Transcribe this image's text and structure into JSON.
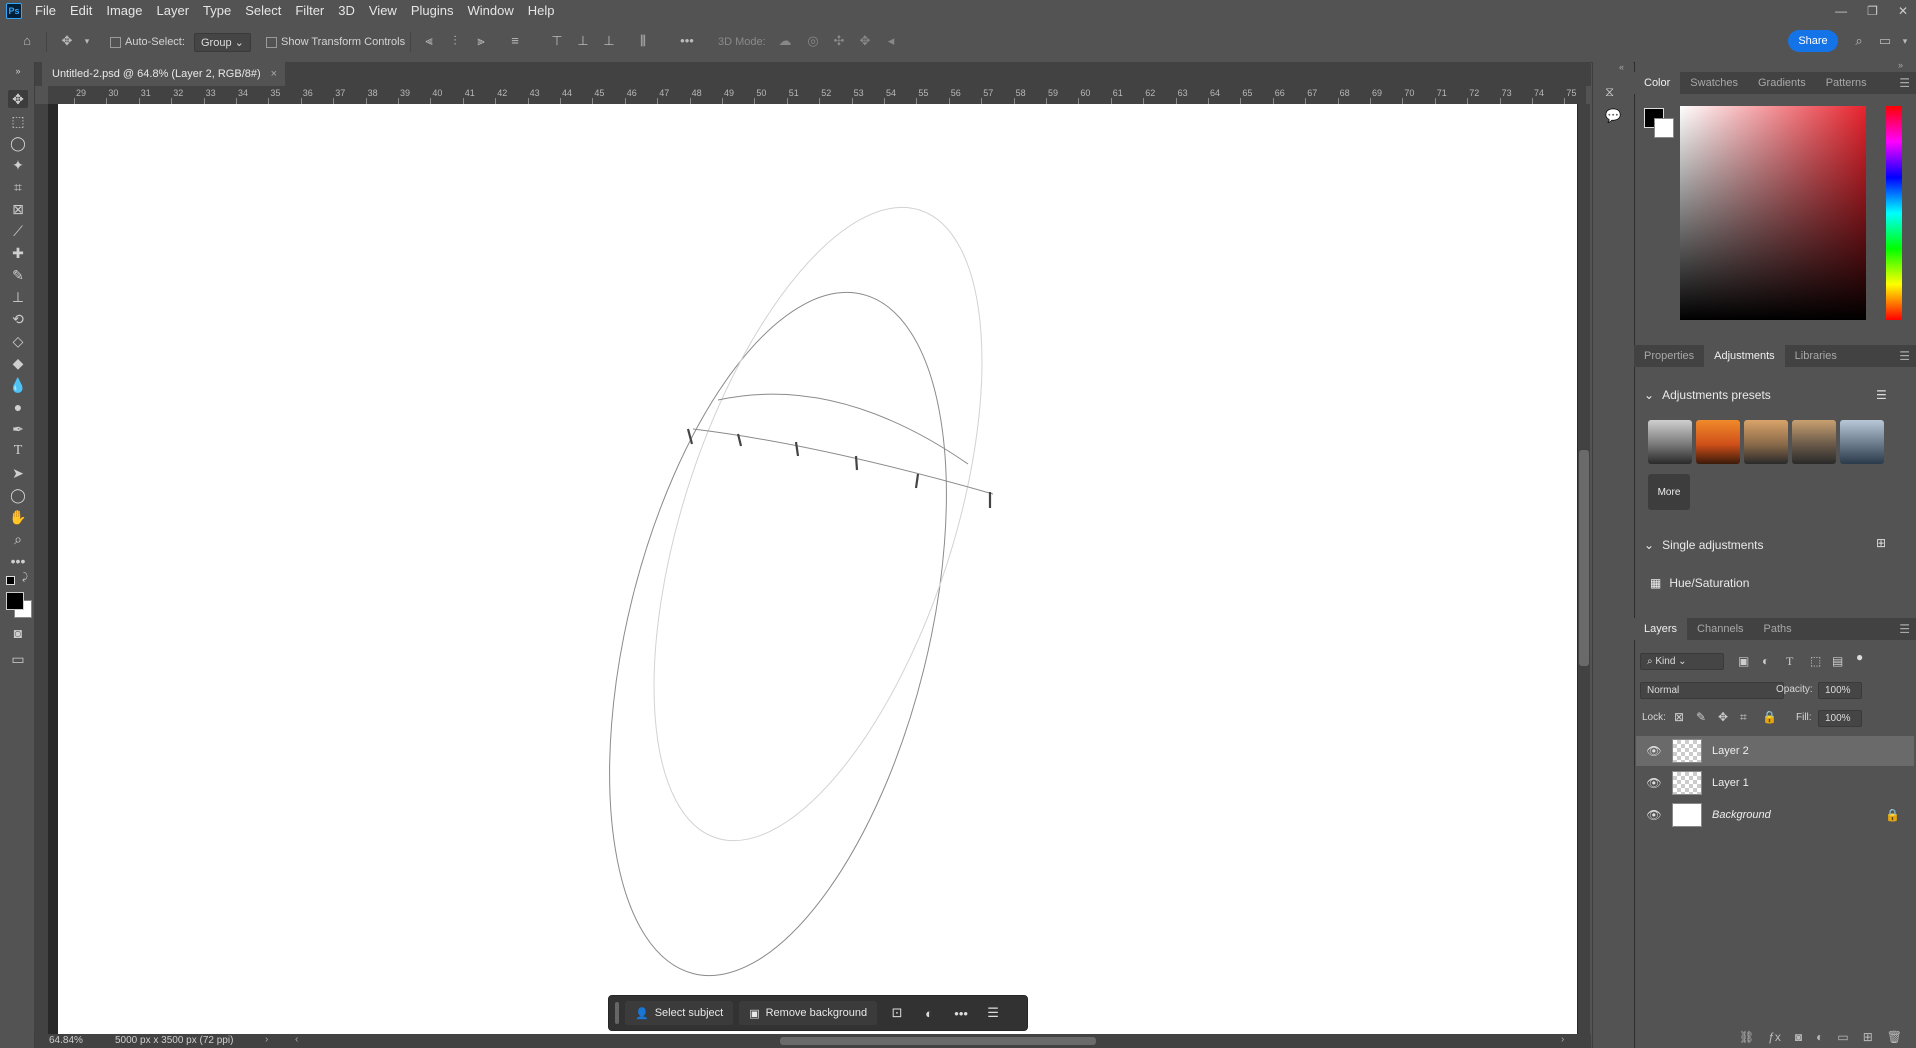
{
  "app": {
    "menus": [
      "File",
      "Edit",
      "Image",
      "Layer",
      "Type",
      "Select",
      "Filter",
      "3D",
      "View",
      "Plugins",
      "Window",
      "Help"
    ],
    "logo_text": "Ps"
  },
  "options": {
    "auto_select_label": "Auto-Select:",
    "auto_select_value": "Group",
    "show_transform_label": "Show Transform Controls",
    "mode_3d_label": "3D Mode:",
    "share_label": "Share"
  },
  "document": {
    "tab_title": "Untitled-2.psd @ 64.8% (Layer 2, RGB/8#)",
    "close_glyph": "×",
    "zoom": "64.84%",
    "dimensions": "5000 px x 3500 px (72 ppi)"
  },
  "ruler": {
    "h_labels": [
      "29",
      "30",
      "31",
      "32",
      "33",
      "34",
      "35",
      "36",
      "37",
      "38",
      "39",
      "40",
      "41",
      "42",
      "43",
      "44",
      "45",
      "46",
      "47",
      "48",
      "49",
      "50",
      "51",
      "52",
      "53",
      "54",
      "55",
      "56",
      "57",
      "58",
      "59",
      "60",
      "61",
      "62",
      "63",
      "64",
      "65",
      "66",
      "67",
      "68",
      "69",
      "70",
      "71",
      "72",
      "73",
      "74",
      "75"
    ]
  },
  "taskbar": {
    "select_subject": "Select subject",
    "remove_background": "Remove background"
  },
  "color_panel": {
    "tabs": [
      "Color",
      "Swatches",
      "Gradients",
      "Patterns"
    ],
    "foreground": "#000000",
    "background": "#ffffff"
  },
  "adjustments_panel": {
    "tabs": [
      "Properties",
      "Adjustments",
      "Libraries"
    ],
    "presets_heading": "Adjustments presets",
    "more_label": "More",
    "single_heading": "Single adjustments",
    "items": [
      "Hue/Saturation"
    ]
  },
  "layers_panel": {
    "tabs": [
      "Layers",
      "Channels",
      "Paths"
    ],
    "filter_kind": "Kind",
    "blend_mode": "Normal",
    "opacity_label": "Opacity:",
    "opacity_value": "100%",
    "lock_label": "Lock:",
    "fill_label": "Fill:",
    "fill_value": "100%",
    "layers": [
      {
        "name": "Layer 2",
        "selected": true
      },
      {
        "name": "Layer 1",
        "selected": false
      },
      {
        "name": "Background",
        "selected": false
      }
    ]
  }
}
